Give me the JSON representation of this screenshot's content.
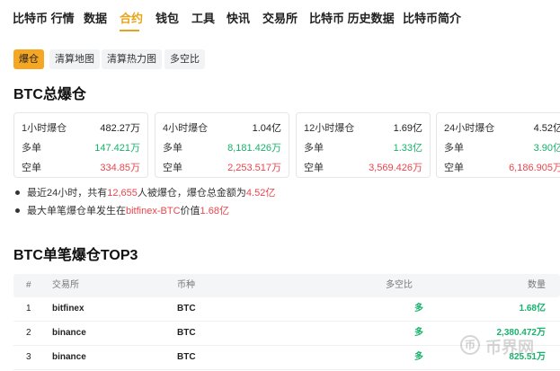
{
  "nav": {
    "items": [
      "比特币 行情",
      "数据",
      "合约",
      "钱包",
      "工具",
      "快讯",
      "交易所",
      "比特币 历史数据",
      "比特币简介"
    ],
    "active": "合约"
  },
  "subtabs": [
    "爆仓",
    "清算地图",
    "清算热力图",
    "多空比"
  ],
  "summary": {
    "title": "BTC总爆仓",
    "long_label": "多单",
    "short_label": "空单",
    "cards": [
      {
        "period": "1小时爆仓",
        "total": "482.27万",
        "long": "147.421万",
        "short": "334.85万"
      },
      {
        "period": "4小时爆仓",
        "total": "1.04亿",
        "long": "8,181.426万",
        "short": "2,253.517万"
      },
      {
        "period": "12小时爆仓",
        "total": "1.69亿",
        "long": "1.33亿",
        "short": "3,569.426万"
      },
      {
        "period": "24小时爆仓",
        "total": "4.52亿",
        "long": "3.90亿",
        "short": "6,186.905万"
      }
    ]
  },
  "notes": {
    "line1": {
      "prefix": "最近24小时，共有",
      "count": "12,655",
      "middle": "人被爆仓，爆仓总金额为",
      "amount": "4.52亿"
    },
    "line2": {
      "prefix": "最大单笔爆仓单发生在",
      "source": "bitfinex-BTC",
      "middle": "价值",
      "amount": "1.68亿"
    }
  },
  "top3": {
    "title": "BTC单笔爆仓TOP3",
    "headers": {
      "num": "#",
      "exchange": "交易所",
      "coin": "币种",
      "side": "多空比",
      "qty": "数量"
    },
    "rows": [
      {
        "num": "1",
        "exchange": "bitfinex",
        "coin": "BTC",
        "side": "多",
        "qty": "1.68亿"
      },
      {
        "num": "2",
        "exchange": "binance",
        "coin": "BTC",
        "side": "多",
        "qty": "2,380.472万"
      },
      {
        "num": "3",
        "exchange": "binance",
        "coin": "BTC",
        "side": "多",
        "qty": "825.51万"
      }
    ]
  },
  "watermark": {
    "glyph": "币",
    "text": "币界网"
  },
  "colors": {
    "accent": "#e8a317",
    "tab_active": "#f5a623",
    "long": "#18b26b",
    "short": "#e8464e"
  }
}
